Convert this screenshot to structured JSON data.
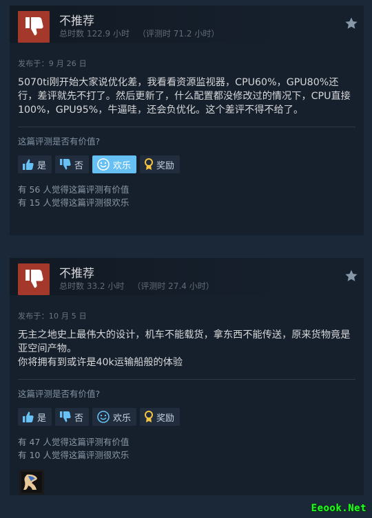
{
  "reviews": [
    {
      "verdict": "不推荐",
      "hours": "总时数 122.9 小时",
      "hours_at_review": "（评测时 71.2 小时）",
      "posted": "发布于：9 月 26 日",
      "content": "5070ti刚开始大家说优化差，我看看资源监视器，CPU60%，GPU80%还行，差评就先不打了。然后更新了，什么配置都没修改过的情况下，CPU直接100%，GPU95%，牛逼哇，还会负优化。这个差评不得不给了。",
      "question": "这篇评测是否有价值?",
      "buttons": {
        "yes": "是",
        "no": "否",
        "funny": "欢乐",
        "award": "奖励"
      },
      "funny_active": true,
      "helpful_count": "有 56 人觉得这篇评测有价值",
      "funny_count": "有 15 人觉得这篇评测很欢乐"
    },
    {
      "verdict": "不推荐",
      "hours": "总时数 33.2 小时",
      "hours_at_review": "（评测时 27.4 小时）",
      "posted": "发布于：10 月 5 日",
      "content_lines": [
        "无主之地史上最伟大的设计，机车不能载货，拿东西不能传送，原来货物竟是亚空间产物。",
        "你将拥有到或许是40k运输船般的体验"
      ],
      "question": "这篇评测是否有价值?",
      "buttons": {
        "yes": "是",
        "no": "否",
        "funny": "欢乐",
        "award": "奖励"
      },
      "funny_active": false,
      "helpful_count": "有 47 人觉得这篇评测有价值",
      "funny_count": "有 10 人觉得这篇评测很欢乐"
    }
  ],
  "watermark": "Eeook.Net",
  "colors": {
    "page_bg": "#1b2838",
    "card_bg": "#16202d",
    "thumb_down_bg": "#a3382b",
    "active_button": "#66c0f4",
    "watermark": "#21ff21"
  },
  "icons": [
    "thumbs-down-icon",
    "star-icon",
    "thumbs-up-icon",
    "smile-icon",
    "award-icon",
    "avatar-icon"
  ]
}
